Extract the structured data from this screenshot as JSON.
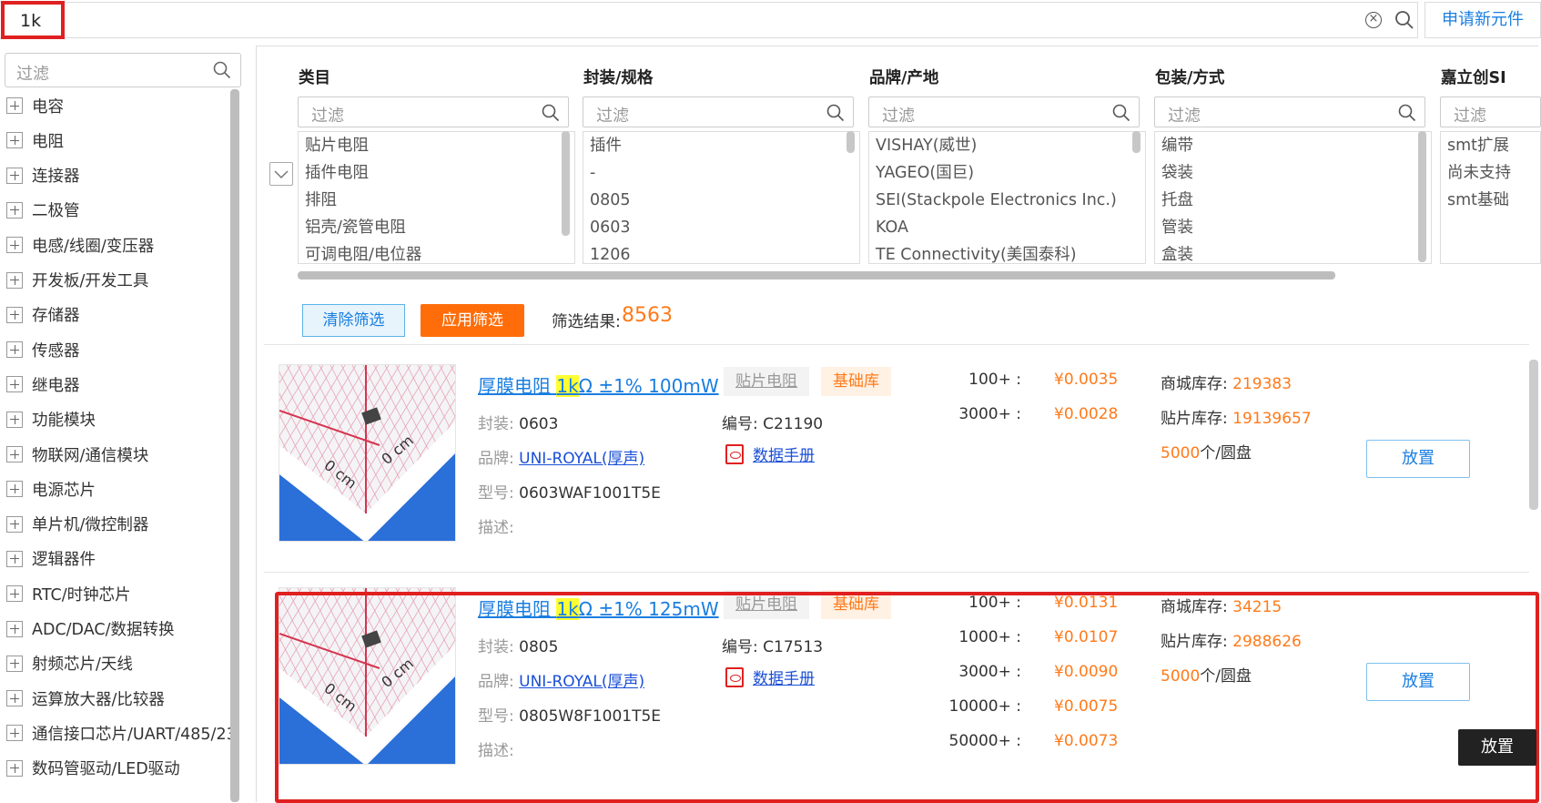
{
  "search": {
    "value": "1k",
    "apply_new": "申请新元件"
  },
  "left_panel": {
    "filter_placeholder": "过滤",
    "items": [
      "电容",
      "电阻",
      "连接器",
      "二极管",
      "电感/线圈/变压器",
      "开发板/开发工具",
      "存储器",
      "传感器",
      "继电器",
      "功能模块",
      "物联网/通信模块",
      "电源芯片",
      "单片机/微控制器",
      "逻辑器件",
      "RTC/时钟芯片",
      "ADC/DAC/数据转换",
      "射频芯片/天线",
      "运算放大器/比较器",
      "通信接口芯片/UART/485/23",
      "数码管驱动/LED驱动"
    ]
  },
  "filters": {
    "columns": [
      {
        "header": "类目",
        "placeholder": "过滤",
        "options": [
          "贴片电阻",
          "插件电阻",
          "排阻",
          "铝壳/瓷管电阻",
          "可调电阻/电位器"
        ]
      },
      {
        "header": "封装/规格",
        "placeholder": "过滤",
        "options": [
          "插件",
          "-",
          "0805",
          "0603",
          "1206"
        ]
      },
      {
        "header": "品牌/产地",
        "placeholder": "过滤",
        "options": [
          "VISHAY(威世)",
          "YAGEO(国巨)",
          "SEI(Stackpole Electronics Inc.)",
          "KOA",
          "TE Connectivity(美国泰科)"
        ]
      },
      {
        "header": "包装/方式",
        "placeholder": "过滤",
        "options": [
          "编带",
          "袋装",
          "托盘",
          "管装",
          "盒装"
        ]
      },
      {
        "header": "嘉立创SI",
        "placeholder": "过滤",
        "options": [
          "smt扩展",
          "尚未支持",
          "smt基础"
        ]
      }
    ],
    "clear_label": "清除筛选",
    "apply_label": "应用筛选",
    "result_label": "筛选结果:",
    "result_count": "8563"
  },
  "products": [
    {
      "title_pre": "厚膜电阻 ",
      "title_hl": "1k",
      "title_post": "Ω ±1% 100mW",
      "category_tag": "贴片电阻",
      "lib_tag": "基础库",
      "package_label": "封装:",
      "package": "0603",
      "code_label": "编号:",
      "code": "C21190",
      "brand_label": "品牌:",
      "brand": "UNI-ROYAL(厚声)",
      "datasheet": "数据手册",
      "model_label": "型号:",
      "model": "0603WAF1001T5E",
      "desc_label": "描述:",
      "prices": [
        {
          "qty": "100+ :",
          "price": "¥0.0035"
        },
        {
          "qty": "3000+ :",
          "price": "¥0.0028"
        }
      ],
      "mall_stock_label": "商城库存:",
      "mall_stock": "219383",
      "smt_stock_label": "贴片库存:",
      "smt_stock": "19139657",
      "reel_qty": "5000",
      "reel_unit": "个/圆盘",
      "place_label": "放置"
    },
    {
      "title_pre": "厚膜电阻 ",
      "title_hl": "1k",
      "title_post": "Ω ±1% 125mW",
      "category_tag": "贴片电阻",
      "lib_tag": "基础库",
      "package_label": "封装:",
      "package": "0805",
      "code_label": "编号:",
      "code": "C17513",
      "brand_label": "品牌:",
      "brand": "UNI-ROYAL(厚声)",
      "datasheet": "数据手册",
      "model_label": "型号:",
      "model": "0805W8F1001T5E",
      "desc_label": "描述:",
      "prices": [
        {
          "qty": "100+ :",
          "price": "¥0.0131"
        },
        {
          "qty": "1000+ :",
          "price": "¥0.0107"
        },
        {
          "qty": "3000+ :",
          "price": "¥0.0090"
        },
        {
          "qty": "10000+ :",
          "price": "¥0.0075"
        },
        {
          "qty": "50000+ :",
          "price": "¥0.0073"
        }
      ],
      "mall_stock_label": "商城库存:",
      "mall_stock": "34215",
      "smt_stock_label": "贴片库存:",
      "smt_stock": "2988626",
      "reel_qty": "5000",
      "reel_unit": "个/圆盘",
      "place_label": "放置"
    }
  ],
  "tooltip": "放置",
  "thumb_text": "0 cm"
}
